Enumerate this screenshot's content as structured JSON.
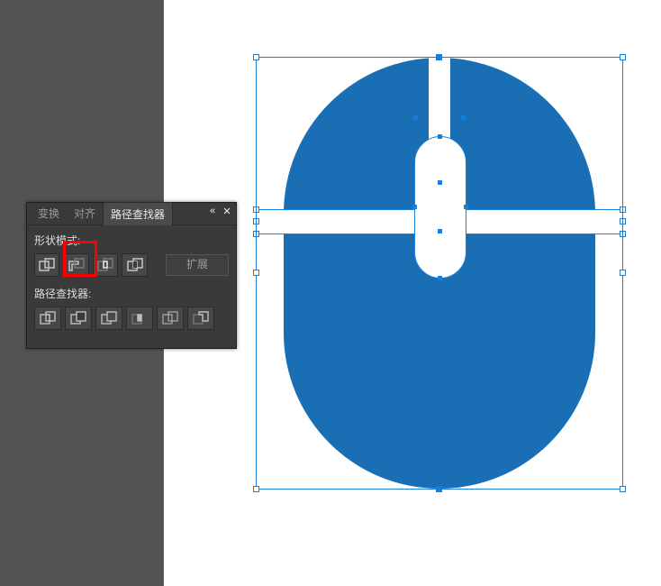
{
  "panel": {
    "tabs": {
      "transform": "变换",
      "align": "对齐",
      "pathfinder": "路径查找器"
    },
    "shape_modes_label": "形状模式:",
    "pathfinder_label": "路径查找器:",
    "expand_label": "扩展",
    "icons": {
      "unite": "unite",
      "minus_front": "minus-front",
      "intersect": "intersect",
      "exclude": "exclude",
      "divide": "divide",
      "trim": "trim",
      "merge": "merge",
      "crop": "crop",
      "outline": "outline",
      "minus_back": "minus-back"
    },
    "controls": {
      "collapse": "«",
      "close": "✕"
    }
  },
  "artwork": {
    "fill_color": "#1a6fb4",
    "selection_color": "#1a7ed6"
  }
}
